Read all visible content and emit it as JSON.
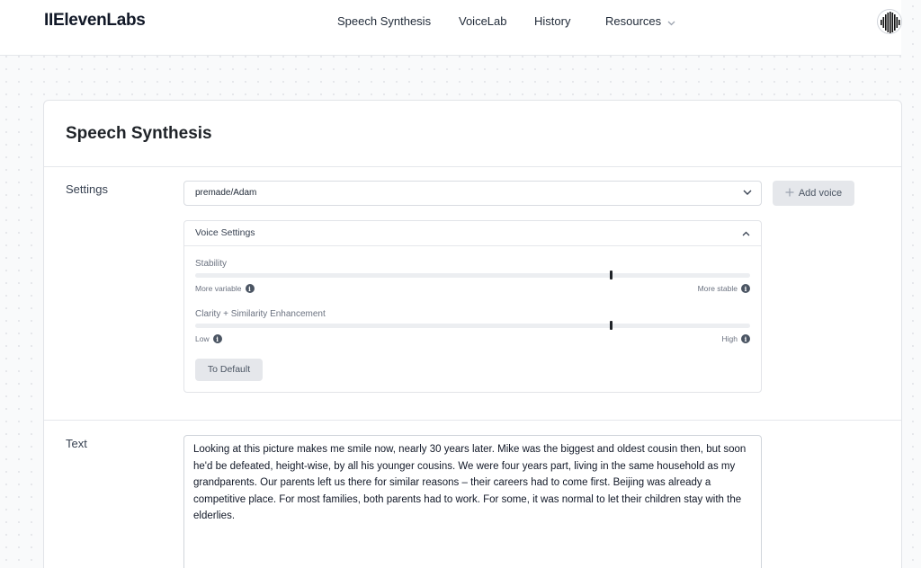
{
  "header": {
    "logo": "IIElevenLabs",
    "nav": [
      {
        "label": "Speech Synthesis"
      },
      {
        "label": "VoiceLab"
      },
      {
        "label": "History"
      },
      {
        "label": "Resources"
      }
    ]
  },
  "main": {
    "title": "Speech Synthesis",
    "settings": {
      "label": "Settings",
      "voice_value": "premade/Adam",
      "add_voice_label": "Add voice",
      "voice_settings": {
        "title": "Voice Settings",
        "stability": {
          "label": "Stability",
          "min_label": "More variable",
          "max_label": "More stable",
          "value": 0.75
        },
        "clarity": {
          "label": "Clarity + Similarity Enhancement",
          "min_label": "Low",
          "max_label": "High",
          "value": 0.75
        },
        "to_default_label": "To Default"
      }
    },
    "text_section": {
      "label": "Text",
      "content": "Looking at this picture makes me smile now, nearly 30 years later. Mike was the biggest and oldest cousin then, but soon he'd be defeated, height-wise, by all his younger cousins. We were four years part, living in the same household as my grandparents. Our parents left us there for similar reasons – their careers had to come first. Beijing was already a competitive place. For most families, both parents had to work. For some, it was normal to let their children stay with the elderlies."
    }
  },
  "colors": {
    "accent": "#1f2328",
    "button_bg": "#e5e7eb",
    "border": "#e2e4e8"
  },
  "icons": [
    "chevron-down-icon",
    "chevron-up-icon",
    "plus-icon",
    "info-icon",
    "waveform-avatar-icon"
  ]
}
